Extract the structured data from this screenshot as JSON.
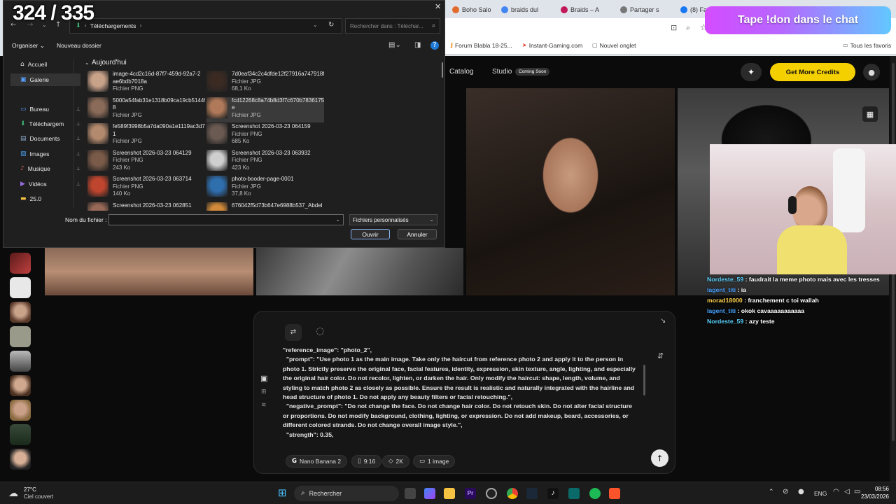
{
  "overlay": {
    "counter": "324 / 335",
    "donate_banner": "Tape !don dans le chat"
  },
  "browser": {
    "tabs": [
      {
        "label": "Boho Salo",
        "color": "#e26a2c"
      },
      {
        "label": "braids dul",
        "color": "#4285f4"
      },
      {
        "label": "Braids – A",
        "color": "#c2185b"
      },
      {
        "label": "Partager s",
        "color": "#777777"
      },
      {
        "label": "(8) Fa",
        "color": "#1877f2"
      }
    ],
    "bookmarks": [
      {
        "label": "Forum Blabla 18-25...",
        "icon": "jv-icon"
      },
      {
        "label": "Instant-Gaming.com",
        "icon": "ig-icon"
      },
      {
        "label": "Nouvel onglet",
        "icon": "page-icon"
      },
      {
        "label": "Tous les favoris",
        "icon": "folder-icon"
      }
    ]
  },
  "site": {
    "nav": [
      {
        "label": "Catalog"
      },
      {
        "label": "Studio"
      }
    ],
    "studio_badge": "Coming Soon",
    "cta_label": "Get More Credits",
    "accent": "#f5d000",
    "prompt_lines": [
      "\"reference_image\": \"photo_2\",",
      "  \"prompt\": \"Use photo 1 as the main image. Take only the haircut from reference photo 2 and apply it to the person in",
      "photo 1. Strictly preserve the original face, facial features, identity, expression, skin texture, angle, lighting, and especially",
      "the original hair color. Do not recolor, lighten, or darken the hair. Only modify the haircut: shape, length, volume, and",
      "styling to match photo 2 as closely as possible. Ensure the result is realistic and naturally integrated with the hairline and",
      "head structure of photo 1. Do not apply any beauty filters or facial retouching.\",",
      "  \"negative_prompt\": \"Do not change the face. Do not change hair color. Do not retouch skin. Do not alter facial structure",
      "or proportions. Do not modify background, clothing, lighting, or expression. Do not add makeup, beard, accessories, or",
      "different colored strands. Do not change overall image style.\",",
      "  \"strength\": 0.35,"
    ],
    "chips": [
      {
        "label": "Nano Banana 2",
        "icon": "google-icon"
      },
      {
        "label": "9:16",
        "icon": "phone-icon"
      },
      {
        "label": "2K",
        "icon": "diamond-icon"
      },
      {
        "label": "1 image",
        "icon": "images-icon"
      }
    ]
  },
  "chat": [
    {
      "user": "Nordeste_59",
      "color": "#5cd4ff",
      "text": "faudrait la meme photo mais avec les tresses"
    },
    {
      "user": "lagent_titi",
      "color": "#4aa3ff",
      "text": "ia"
    },
    {
      "user": "morad18000",
      "color": "#ffd24a",
      "text": "franchement c toi wallah"
    },
    {
      "user": "lagent_titi",
      "color": "#4aa3ff",
      "text": "okok cavaaaaaaaaaaa"
    },
    {
      "user": "Nordeste_59",
      "color": "#5cd4ff",
      "text": "azy teste"
    }
  ],
  "dialog": {
    "path": "Téléchargements",
    "search_placeholder": "Rechercher dans : Téléchar...",
    "organize": "Organiser",
    "new_folder": "Nouveau dossier",
    "group": "Aujourd'hui",
    "sidebar": [
      {
        "label": "Accueil",
        "icon": "home-icon",
        "pinned": false
      },
      {
        "label": "Galerie",
        "icon": "gallery-icon",
        "pinned": false
      },
      {
        "label": "Bureau",
        "icon": "desktop-icon",
        "pinned": true
      },
      {
        "label": "Téléchargem",
        "icon": "download-icon",
        "pinned": true
      },
      {
        "label": "Documents",
        "icon": "documents-icon",
        "pinned": true
      },
      {
        "label": "Images",
        "icon": "images-icon",
        "pinned": true
      },
      {
        "label": "Musique",
        "icon": "music-icon",
        "pinned": true
      },
      {
        "label": "Vidéos",
        "icon": "video-icon",
        "pinned": true
      },
      {
        "label": "25.0",
        "icon": "folder-icon",
        "pinned": false
      }
    ],
    "files_left": [
      {
        "name1": "image-4cd2c16d-87f7-459d-92a7-2",
        "name2": "ae6bdb7018a",
        "type": "Fichier PNG",
        "size": "",
        "tone": "#c9a28a"
      },
      {
        "name1": "5000a54fab31e1318b09ca19cb51449",
        "name2": "8",
        "type": "Fichier JPG",
        "size": "",
        "tone": "#8a6a58"
      },
      {
        "name1": "fe589f3998b5a7da090a1e1119ac3d7",
        "name2": "1",
        "type": "Fichier JPG",
        "size": "",
        "tone": "#b48a6e"
      },
      {
        "name1": "Screenshot 2026-03-23 064129",
        "name2": "",
        "type": "Fichier PNG",
        "size": "243 Ko",
        "tone": "#7a5a48"
      },
      {
        "name1": "Screenshot 2026-03-23 063714",
        "name2": "",
        "type": "Fichier PNG",
        "size": "140 Ko",
        "tone": "#c0452e"
      },
      {
        "name1": "Screenshot 2026-03-23 062851",
        "name2": "",
        "type": "",
        "size": "",
        "tone": "#9a6a58"
      }
    ],
    "files_right": [
      {
        "name1": "7d0eaf34c2c4dfde12f27916a747918f",
        "name2": "",
        "type": "Fichier JPG",
        "size": "68,1 Ko",
        "tone": "#3a2a22"
      },
      {
        "name1": "fcd12268c8a74b8d3f7c670b7836175",
        "name2": "e",
        "type": "Fichier JPG",
        "size": "",
        "tone": "#b07a5a"
      },
      {
        "name1": "Screenshot 2026-03-23 064159",
        "name2": "",
        "type": "Fichier PNG",
        "size": "685 Ko",
        "tone": "#6a5a52"
      },
      {
        "name1": "Screenshot 2026-03-23 063932",
        "name2": "",
        "type": "Fichier PNG",
        "size": "423 Ko",
        "tone": "#cfcfcf"
      },
      {
        "name1": "photo-booder-page-0001",
        "name2": "",
        "type": "Fichier JPG",
        "size": "37,8 Ko",
        "tone": "#2f6fae"
      },
      {
        "name1": "676042f5d73b647e6988b537_Abdel",
        "name2": "",
        "type": "",
        "size": "",
        "tone": "#d08a3a"
      }
    ],
    "filename_label": "Nom du fichier :",
    "filename_value": "",
    "filter": "Fichiers personnalisés",
    "open": "Ouvrir",
    "cancel": "Annuler"
  },
  "taskbar": {
    "temp": "27°C",
    "weather": "Ciel couvert",
    "search": "Rechercher",
    "lang": "ENG",
    "time": "08:56",
    "date": "23/03/2026"
  }
}
